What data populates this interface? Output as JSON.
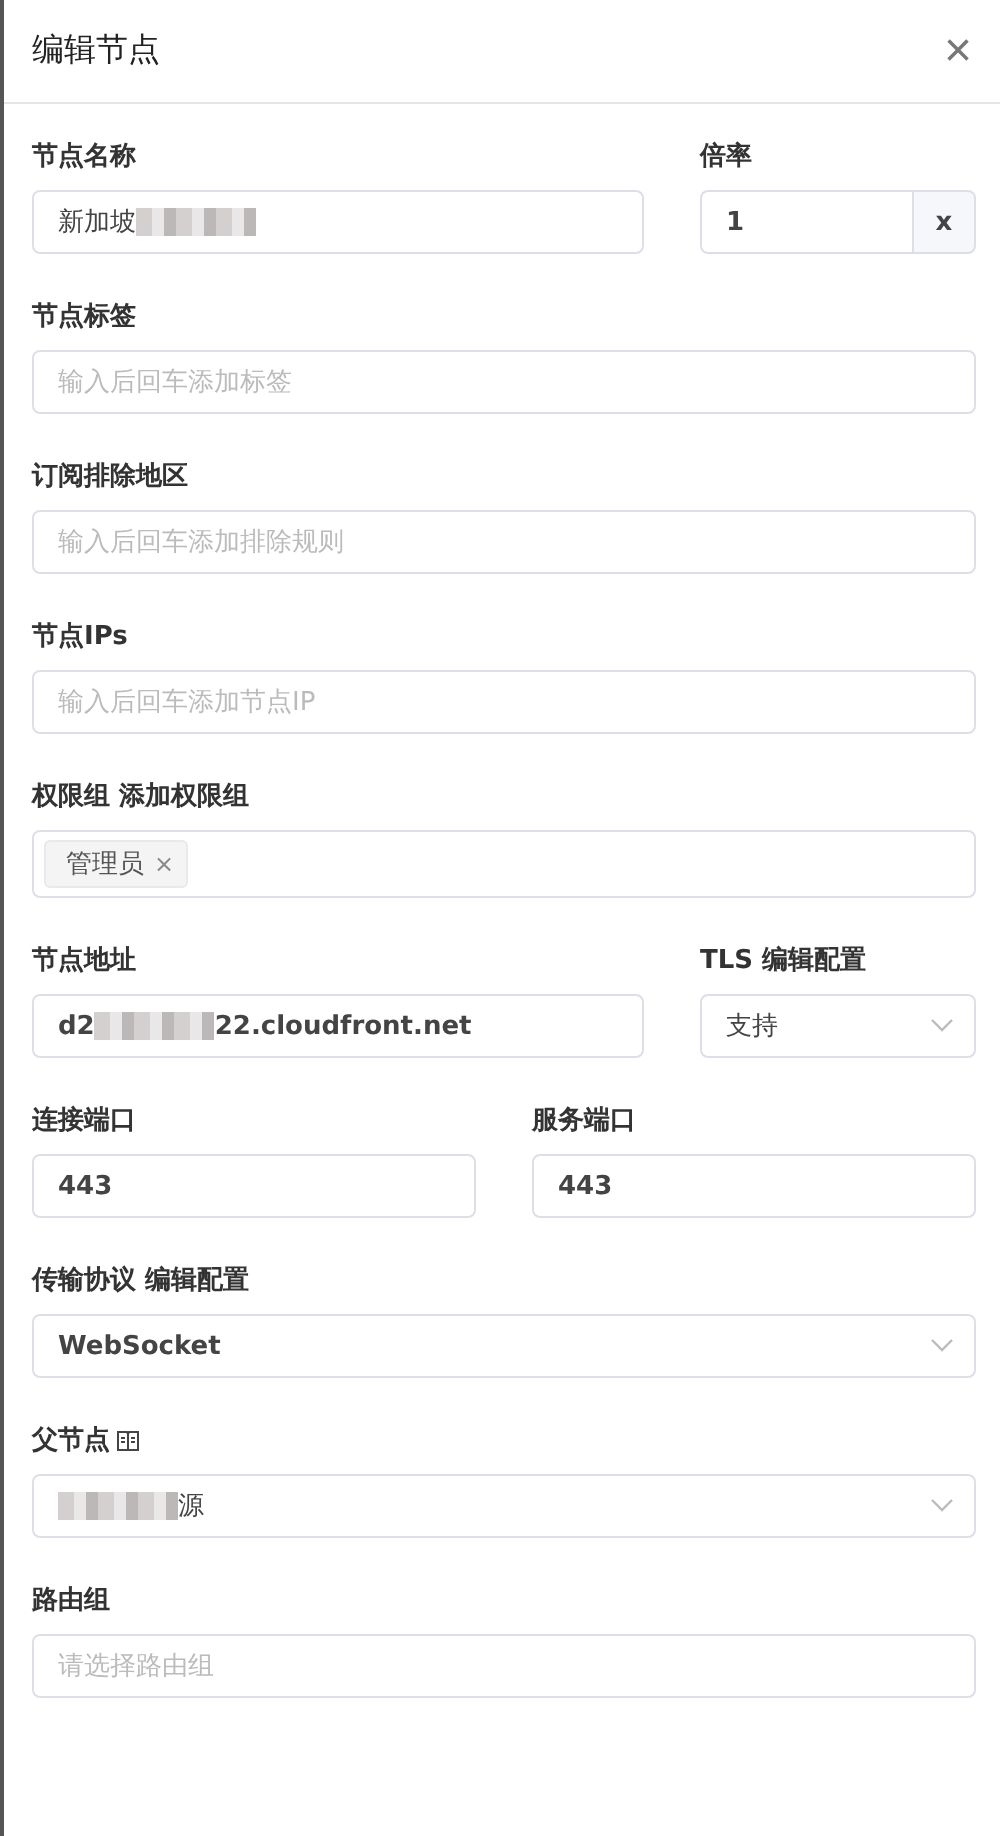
{
  "drawer": {
    "title": "编辑节点",
    "close": "×"
  },
  "rows": [
    {
      "fields": [
        {
          "label": "节点名称",
          "kind": "input",
          "segments": [
            {
              "kind": "text",
              "text": "新加坡"
            },
            {
              "kind": "blur"
            }
          ]
        },
        {
          "label": "倍率",
          "kind": "append",
          "value": "1",
          "append": "x"
        }
      ]
    },
    {
      "fields": [
        {
          "label": "节点标签",
          "kind": "input",
          "placeholder": "输入后回车添加标签"
        }
      ]
    },
    {
      "fields": [
        {
          "label": "订阅排除地区",
          "kind": "input",
          "placeholder": "输入后回车添加排除规则"
        }
      ]
    },
    {
      "fields": [
        {
          "label": "节点IPs",
          "kind": "input",
          "placeholder": "输入后回车添加节点IP"
        }
      ]
    },
    {
      "fields": [
        {
          "label": "权限组 添加权限组",
          "kind": "tags",
          "tags": [
            {
              "text": "管理员",
              "remove": "×"
            }
          ]
        }
      ]
    },
    {
      "fields": [
        {
          "label": "节点地址",
          "kind": "input",
          "bold": true,
          "segments": [
            {
              "kind": "text",
              "text": "d2"
            },
            {
              "kind": "blur"
            },
            {
              "kind": "text",
              "text": "22.cloudfront.net"
            }
          ]
        },
        {
          "label": "TLS 编辑配置",
          "kind": "select",
          "value": "支持"
        }
      ]
    },
    {
      "fields": [
        {
          "label": "连接端口",
          "kind": "input",
          "bold": true,
          "value": "443"
        },
        {
          "label": "服务端口",
          "kind": "input",
          "bold": true,
          "value": "443"
        }
      ]
    },
    {
      "fields": [
        {
          "label": "传输协议 编辑配置",
          "kind": "select",
          "bold": true,
          "value": "WebSocket"
        }
      ]
    },
    {
      "fields": [
        {
          "label": "父节点",
          "label_icon": true,
          "kind": "select",
          "segments": [
            {
              "kind": "blur"
            },
            {
              "kind": "text",
              "text": "源"
            }
          ]
        }
      ]
    },
    {
      "fields": [
        {
          "label": "路由组",
          "kind": "input",
          "placeholder": "请选择路由组"
        }
      ]
    }
  ]
}
